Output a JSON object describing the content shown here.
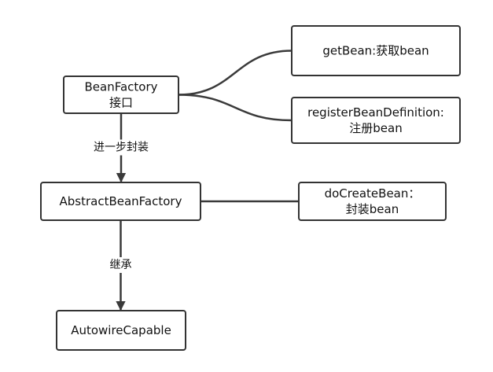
{
  "diagram": {
    "nodes": [
      {
        "id": "beanfactory",
        "lines": [
          "BeanFactory",
          "接口"
        ]
      },
      {
        "id": "getbean",
        "lines": [
          "getBean:获取bean"
        ]
      },
      {
        "id": "registerbean",
        "lines": [
          "registerBeanDefinition:",
          "注册bean"
        ]
      },
      {
        "id": "abstractbeanfactory",
        "lines": [
          "AbstractBeanFactory"
        ]
      },
      {
        "id": "docreatebean",
        "lines": [
          "doCreateBean：",
          "封装bean"
        ]
      },
      {
        "id": "autowirecapable",
        "lines": [
          "AutowireCapable"
        ]
      }
    ],
    "edges": [
      {
        "from": "beanfactory",
        "to": "getbean",
        "label": "",
        "arrow": false
      },
      {
        "from": "beanfactory",
        "to": "registerbean",
        "label": "",
        "arrow": false
      },
      {
        "from": "beanfactory",
        "to": "abstractbeanfactory",
        "label": "进一步封装",
        "arrow": true
      },
      {
        "from": "abstractbeanfactory",
        "to": "docreatebean",
        "label": "",
        "arrow": false
      },
      {
        "from": "abstractbeanfactory",
        "to": "autowirecapable",
        "label": "继承",
        "arrow": true
      }
    ]
  }
}
